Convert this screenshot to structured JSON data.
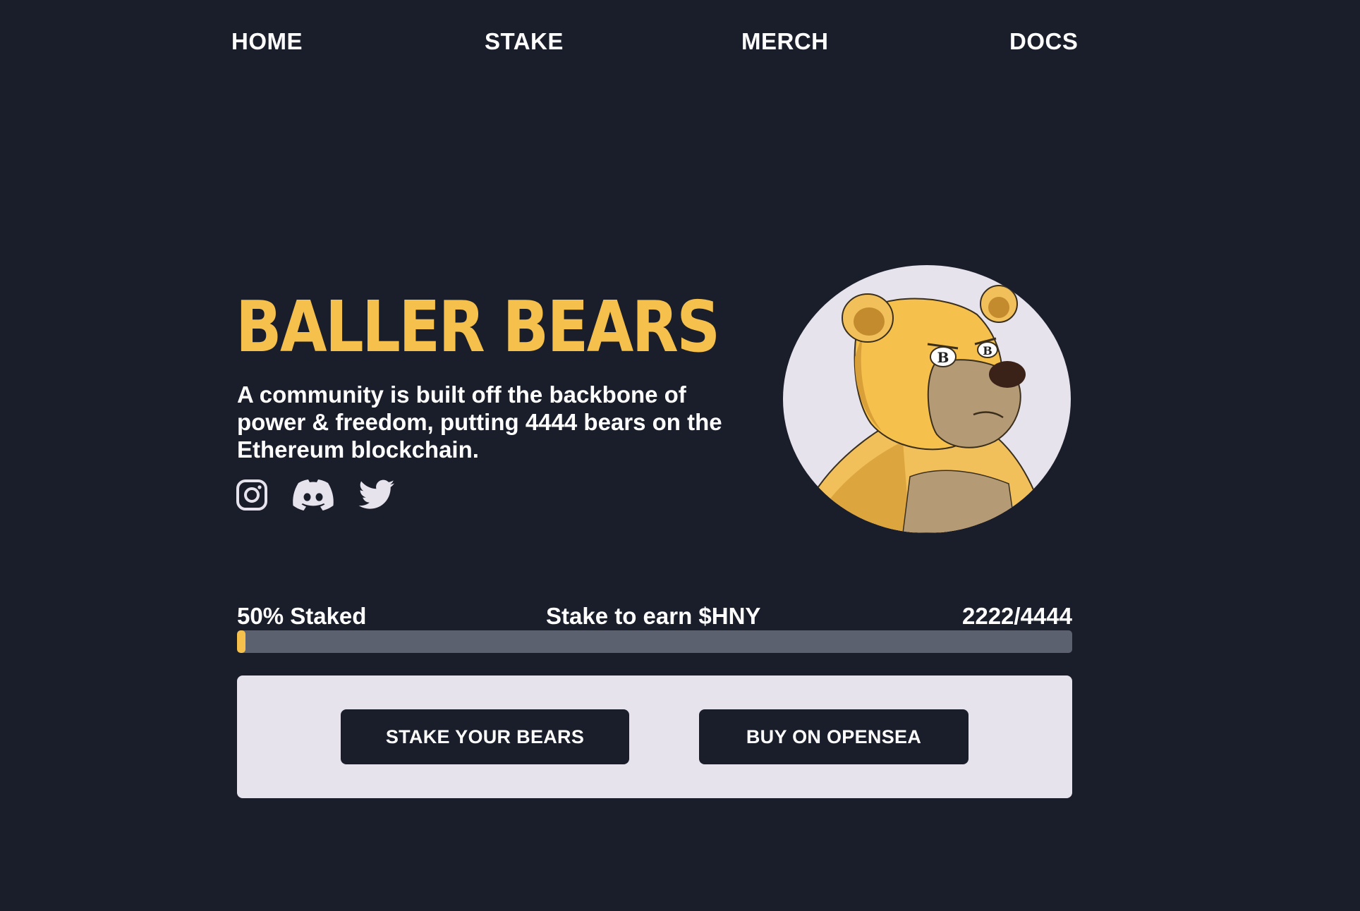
{
  "nav": {
    "items": [
      {
        "label": "HOME"
      },
      {
        "label": "STAKE"
      },
      {
        "label": "MERCH"
      },
      {
        "label": "DOCS"
      }
    ]
  },
  "hero": {
    "title": "BALLER BEARS",
    "description": "A community is built off the backbone of power & freedom, putting 4444 bears on the Ethereum blockchain.",
    "socials": [
      {
        "name": "instagram",
        "icon": "instagram-icon"
      },
      {
        "name": "discord",
        "icon": "discord-icon"
      },
      {
        "name": "twitter",
        "icon": "twitter-icon"
      }
    ]
  },
  "staking": {
    "percent_label": "50% Staked",
    "center_label": "Stake to earn $HNY",
    "count_label": "2222/4444",
    "progress_fraction": 0.01
  },
  "cta": {
    "stake_label": "STAKE YOUR BEARS",
    "buy_label": "BUY ON OPENSEA"
  },
  "colors": {
    "background": "#1a1e2b",
    "accent": "#f5c04c",
    "panel": "#e6e3ec",
    "track": "#5c6170",
    "text": "#ffffff"
  }
}
